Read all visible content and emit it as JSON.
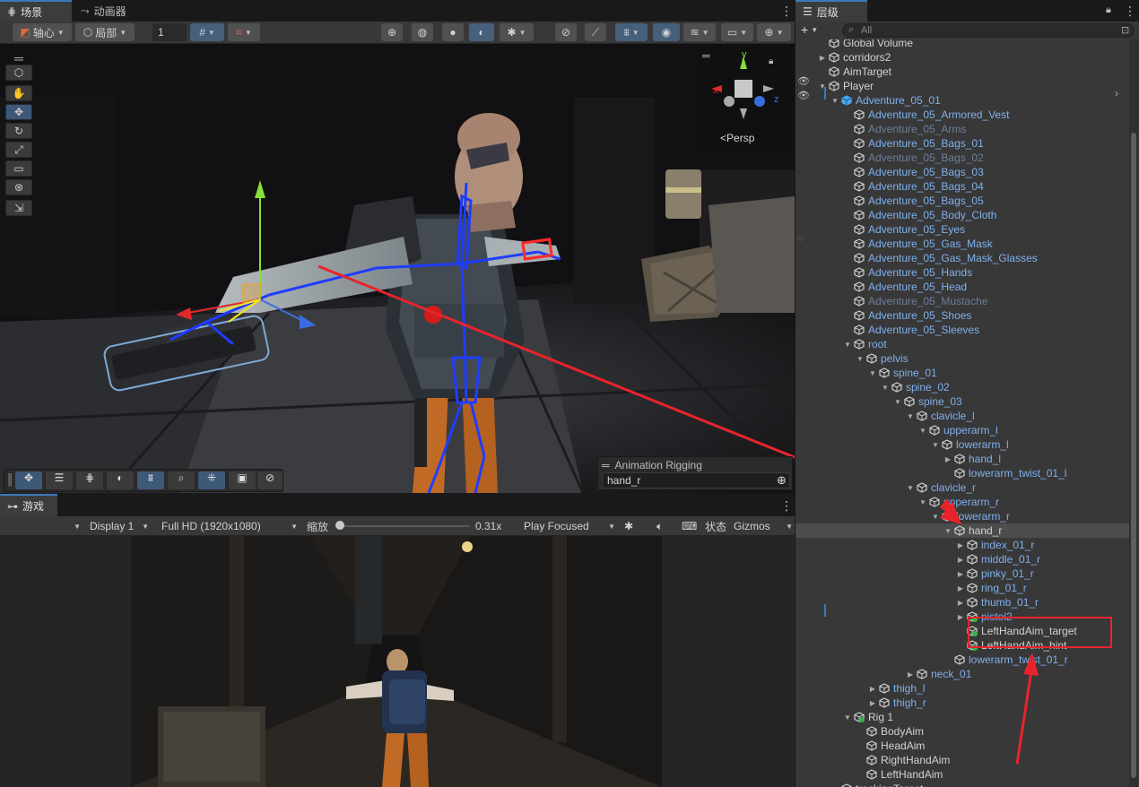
{
  "scene_tabs": {
    "scene": "场景",
    "animator": "动画器"
  },
  "toolbar": {
    "pivot": "轴心",
    "local": "局部",
    "grid_value": "1"
  },
  "gizmo": {
    "y": "y",
    "x": "x",
    "z": "z",
    "projection": "Persp"
  },
  "rigging_overlay": {
    "title": "Animation Rigging",
    "value": "hand_r"
  },
  "game_tab": "游戏",
  "game_bar": {
    "display": "Display 1",
    "resolution": "Full HD (1920x1080)",
    "scale_label": "缩放",
    "scale_value": "0.31x",
    "play_mode": "Play Focused",
    "stats": "状态",
    "gizmos": "Gizmos"
  },
  "hierarchy": {
    "tab": "层级",
    "search_placeholder": "All",
    "rows": [
      {
        "label": "Global Volume",
        "depth": 1,
        "arrow": "",
        "color": "white"
      },
      {
        "label": "corridors2",
        "depth": 1,
        "arrow": "right",
        "color": "white"
      },
      {
        "label": "AimTarget",
        "depth": 1,
        "arrow": "",
        "color": "white"
      },
      {
        "label": "Player",
        "depth": 1,
        "arrow": "down",
        "color": "white"
      },
      {
        "label": "Adventure_05_01",
        "depth": 2,
        "arrow": "down",
        "color": "blue",
        "icon": "prefab"
      },
      {
        "label": "Adventure_05_Armored_Vest",
        "depth": 3,
        "arrow": "",
        "color": "blue"
      },
      {
        "label": "Adventure_05_Arms",
        "depth": 3,
        "arrow": "",
        "color": "dim"
      },
      {
        "label": "Adventure_05_Bags_01",
        "depth": 3,
        "arrow": "",
        "color": "blue"
      },
      {
        "label": "Adventure_05_Bags_02",
        "depth": 3,
        "arrow": "",
        "color": "dim"
      },
      {
        "label": "Adventure_05_Bags_03",
        "depth": 3,
        "arrow": "",
        "color": "blue"
      },
      {
        "label": "Adventure_05_Bags_04",
        "depth": 3,
        "arrow": "",
        "color": "blue"
      },
      {
        "label": "Adventure_05_Bags_05",
        "depth": 3,
        "arrow": "",
        "color": "blue"
      },
      {
        "label": "Adventure_05_Body_Cloth",
        "depth": 3,
        "arrow": "",
        "color": "blue"
      },
      {
        "label": "Adventure_05_Eyes",
        "depth": 3,
        "arrow": "",
        "color": "blue"
      },
      {
        "label": "Adventure_05_Gas_Mask",
        "depth": 3,
        "arrow": "",
        "color": "blue"
      },
      {
        "label": "Adventure_05_Gas_Mask_Glasses",
        "depth": 3,
        "arrow": "",
        "color": "blue"
      },
      {
        "label": "Adventure_05_Hands",
        "depth": 3,
        "arrow": "",
        "color": "blue"
      },
      {
        "label": "Adventure_05_Head",
        "depth": 3,
        "arrow": "",
        "color": "blue"
      },
      {
        "label": "Adventure_05_Mustache",
        "depth": 3,
        "arrow": "",
        "color": "dim"
      },
      {
        "label": "Adventure_05_Shoes",
        "depth": 3,
        "arrow": "",
        "color": "blue"
      },
      {
        "label": "Adventure_05_Sleeves",
        "depth": 3,
        "arrow": "",
        "color": "blue"
      },
      {
        "label": "root",
        "depth": 3,
        "arrow": "down",
        "color": "blue"
      },
      {
        "label": "pelvis",
        "depth": 4,
        "arrow": "down",
        "color": "blue"
      },
      {
        "label": "spine_01",
        "depth": 5,
        "arrow": "down",
        "color": "blue"
      },
      {
        "label": "spine_02",
        "depth": 6,
        "arrow": "down",
        "color": "blue"
      },
      {
        "label": "spine_03",
        "depth": 7,
        "arrow": "down",
        "color": "blue"
      },
      {
        "label": "clavicle_l",
        "depth": 8,
        "arrow": "down",
        "color": "blue"
      },
      {
        "label": "upperarm_l",
        "depth": 9,
        "arrow": "down",
        "color": "blue"
      },
      {
        "label": "lowerarm_l",
        "depth": 10,
        "arrow": "down",
        "color": "blue"
      },
      {
        "label": "hand_l",
        "depth": 11,
        "arrow": "right",
        "color": "blue"
      },
      {
        "label": "lowerarm_twist_01_l",
        "depth": 11,
        "arrow": "",
        "color": "blue"
      },
      {
        "label": "clavicle_r",
        "depth": 8,
        "arrow": "down",
        "color": "blue"
      },
      {
        "label": "upperarm_r",
        "depth": 9,
        "arrow": "down",
        "color": "blue"
      },
      {
        "label": "lowerarm_r",
        "depth": 10,
        "arrow": "down",
        "color": "blue"
      },
      {
        "label": "hand_r",
        "depth": 11,
        "arrow": "down",
        "color": "white",
        "selected": true
      },
      {
        "label": "index_01_r",
        "depth": 12,
        "arrow": "right",
        "color": "blue"
      },
      {
        "label": "middle_01_r",
        "depth": 12,
        "arrow": "right",
        "color": "blue"
      },
      {
        "label": "pinky_01_r",
        "depth": 12,
        "arrow": "right",
        "color": "blue"
      },
      {
        "label": "ring_01_r",
        "depth": 12,
        "arrow": "right",
        "color": "blue"
      },
      {
        "label": "thumb_01_r",
        "depth": 12,
        "arrow": "right",
        "color": "blue"
      },
      {
        "label": "pistol2",
        "depth": 12,
        "arrow": "right",
        "color": "blue",
        "icon": "green"
      },
      {
        "label": "LeftHandAim_target",
        "depth": 12,
        "arrow": "",
        "color": "white",
        "icon": "green"
      },
      {
        "label": "LeftHandAim_hint",
        "depth": 12,
        "arrow": "",
        "color": "white",
        "icon": "green"
      },
      {
        "label": "lowerarm_twist_01_r",
        "depth": 11,
        "arrow": "",
        "color": "blue"
      },
      {
        "label": "neck_01",
        "depth": 8,
        "arrow": "right",
        "color": "blue"
      },
      {
        "label": "thigh_l",
        "depth": 5,
        "arrow": "right",
        "color": "blue"
      },
      {
        "label": "thigh_r",
        "depth": 5,
        "arrow": "right",
        "color": "blue"
      },
      {
        "label": "Rig 1",
        "depth": 3,
        "arrow": "down",
        "color": "white",
        "icon": "green"
      },
      {
        "label": "BodyAim",
        "depth": 4,
        "arrow": "",
        "color": "white"
      },
      {
        "label": "HeadAim",
        "depth": 4,
        "arrow": "",
        "color": "white"
      },
      {
        "label": "RightHandAim",
        "depth": 4,
        "arrow": "",
        "color": "white"
      },
      {
        "label": "LeftHandAim",
        "depth": 4,
        "arrow": "",
        "color": "white"
      },
      {
        "label": "trackingTarget",
        "depth": 2,
        "arrow": "",
        "color": "white"
      }
    ]
  },
  "colors": {
    "accent": "#3a79bb",
    "annotation": "#e8242b",
    "bone": "#1f3cff"
  }
}
